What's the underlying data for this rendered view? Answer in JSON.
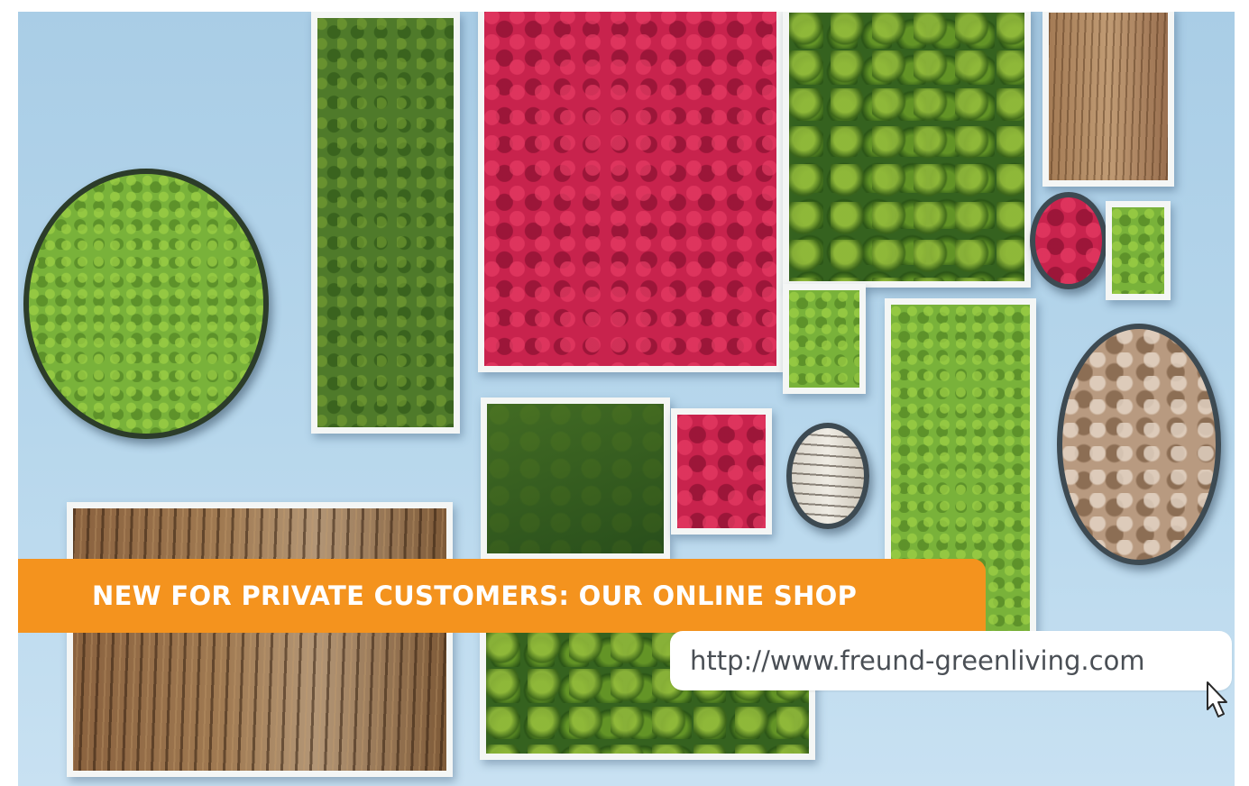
{
  "banner": {
    "headline": "NEW FOR PRIVATE CUSTOMERS: OUR ONLINE SHOP",
    "color": "#f4931e"
  },
  "link": {
    "url": "http://www.freund-greenliving.com"
  },
  "icons": {
    "cursor": "hand-pointer-icon"
  }
}
